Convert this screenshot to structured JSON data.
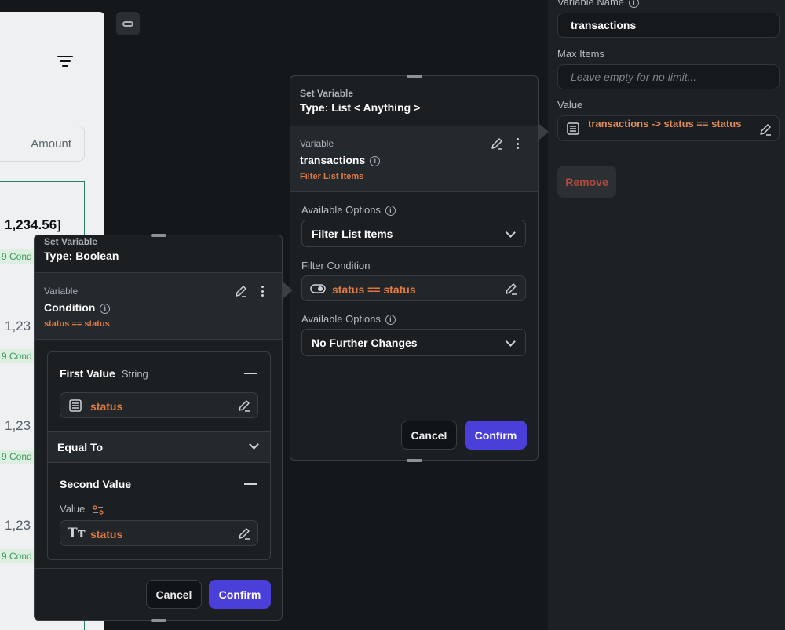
{
  "preview": {
    "amount_chip": "Amount",
    "values": [
      "1,234.56]",
      "1,23",
      "1,23",
      "1,23"
    ],
    "conds": [
      "9 Cond",
      "9 Cond",
      "9 Cond",
      "9 Cond"
    ]
  },
  "right_panel": {
    "variable_name_label": "Variable Name",
    "variable_name_value": "transactions",
    "max_items_label": "Max Items",
    "max_items_placeholder": "Leave empty for no limit...",
    "value_label": "Value",
    "value_text": "transactions -> status  ==  status",
    "remove_label": "Remove"
  },
  "list_card": {
    "title_small": "Set Variable",
    "title_big": "Type: List < Anything >",
    "variable_label": "Variable",
    "variable_name": "transactions",
    "variable_sub": "Filter List Items",
    "available_options_label_1": "Available Options",
    "select_1": "Filter List Items",
    "filter_condition_label": "Filter Condition",
    "filter_condition_value": "status  ==  status",
    "available_options_label_2": "Available Options",
    "select_2": "No Further Changes",
    "cancel": "Cancel",
    "confirm": "Confirm"
  },
  "bool_card": {
    "title_small": "Set Variable",
    "title_big": "Type: Boolean",
    "variable_label": "Variable",
    "variable_name": "Condition",
    "variable_sub": "status  ==  status",
    "first_value_label": "First Value",
    "first_value_type": "String",
    "first_value": "status",
    "operator": "Equal To",
    "second_value_label": "Second Value",
    "value_label": "Value",
    "second_value": "status",
    "cancel": "Cancel",
    "confirm": "Confirm"
  }
}
